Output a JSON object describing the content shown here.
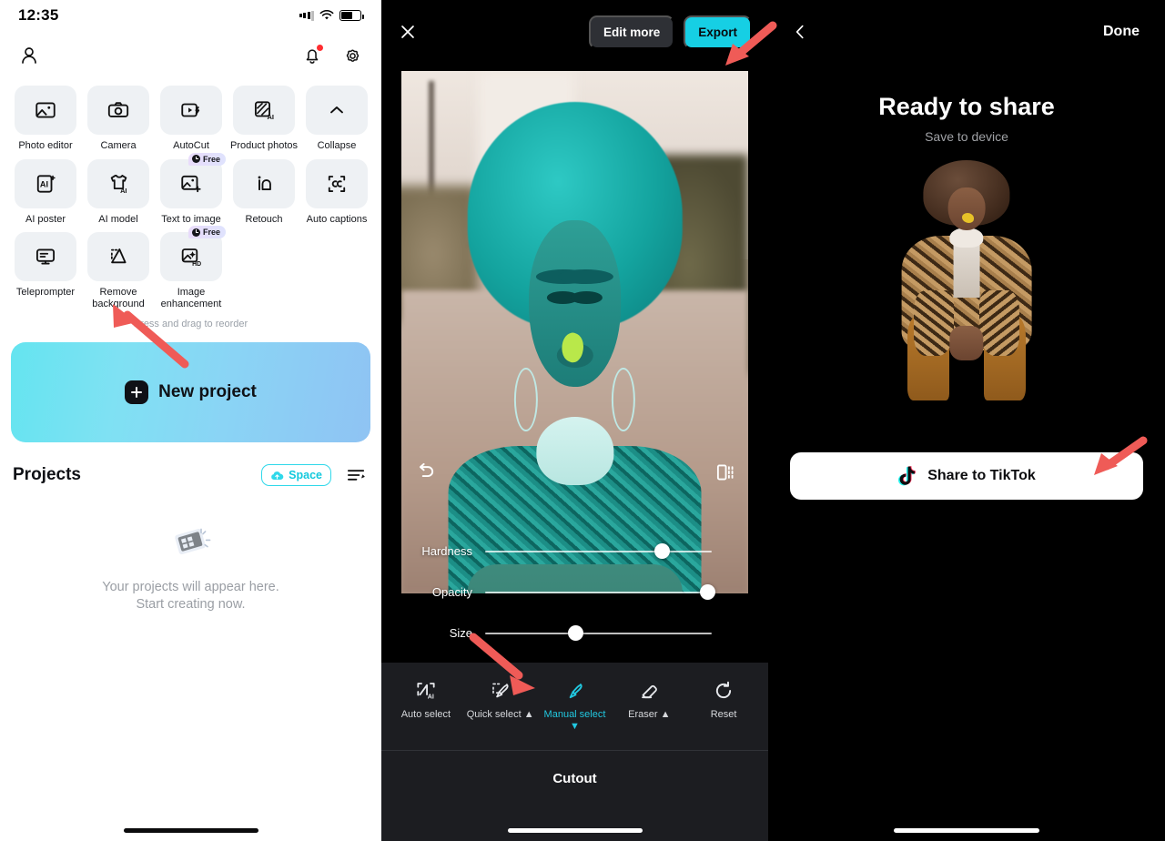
{
  "panel1": {
    "status": {
      "time": "12:35",
      "signal_icon": "cellular-signal-icon",
      "wifi_icon": "wifi-icon",
      "battery_icon": "battery-icon"
    },
    "appbar": {
      "profile_icon": "profile-icon",
      "notifications_icon": "bell-icon",
      "settings_icon": "gear-icon"
    },
    "tools": [
      {
        "label": "Photo editor",
        "icon": "photo-editor-icon",
        "badge": null
      },
      {
        "label": "Camera",
        "icon": "camera-icon",
        "badge": null
      },
      {
        "label": "AutoCut",
        "icon": "autocut-icon",
        "badge": null
      },
      {
        "label": "Product photos",
        "icon": "product-photos-icon",
        "badge": null
      },
      {
        "label": "Collapse",
        "icon": "chevron-up-icon",
        "badge": null
      },
      {
        "label": "AI poster",
        "icon": "ai-poster-icon",
        "badge": null
      },
      {
        "label": "AI model",
        "icon": "ai-model-icon",
        "badge": null
      },
      {
        "label": "Text to image",
        "icon": "text-to-image-icon",
        "badge": "Free"
      },
      {
        "label": "Retouch",
        "icon": "retouch-icon",
        "badge": null
      },
      {
        "label": "Auto captions",
        "icon": "auto-captions-icon",
        "badge": null
      },
      {
        "label": "Teleprompter",
        "icon": "teleprompter-icon",
        "badge": null
      },
      {
        "label": "Remove background",
        "icon": "remove-background-icon",
        "badge": null
      },
      {
        "label": "Image enhancement",
        "icon": "image-enhancement-icon",
        "badge": "Free"
      }
    ],
    "reorder_hint": "Press and drag to reorder",
    "new_project": {
      "label": "New project",
      "icon": "plus-icon"
    },
    "projects": {
      "title": "Projects",
      "space_label": "Space",
      "space_icon": "cloud-upload-icon",
      "list_view_icon": "list-edit-icon",
      "empty_icon": "film-strip-icon",
      "empty_line1": "Your projects will appear here.",
      "empty_line2": "Start creating now."
    }
  },
  "panel2": {
    "close_icon": "close-icon",
    "edit_more_label": "Edit more",
    "export_label": "Export",
    "undo_icon": "undo-icon",
    "compare_icon": "compare-icon",
    "sliders": [
      {
        "label": "Hardness",
        "value": 78
      },
      {
        "label": "Opacity",
        "value": 98
      },
      {
        "label": "Size",
        "value": 40
      }
    ],
    "tools": [
      {
        "label": "Auto select",
        "icon": "auto-select-icon",
        "active": false,
        "caret": ""
      },
      {
        "label": "Quick select",
        "icon": "quick-select-icon",
        "active": false,
        "caret": "▲"
      },
      {
        "label": "Manual select",
        "icon": "manual-select-icon",
        "active": true,
        "caret": "▼"
      },
      {
        "label": "Eraser",
        "icon": "eraser-icon",
        "active": false,
        "caret": "▲"
      },
      {
        "label": "Reset",
        "icon": "reset-icon",
        "active": false,
        "caret": ""
      }
    ],
    "sheet_title": "Cutout"
  },
  "panel3": {
    "back_icon": "chevron-left-icon",
    "done_label": "Done",
    "title": "Ready to share",
    "subtitle": "Save to device",
    "preview_name": "cutout-preview-image",
    "share_button": {
      "label": "Share to TikTok",
      "icon": "tiktok-icon"
    }
  },
  "colors": {
    "accent_cyan": "#16cfe4",
    "tool_tile": "#eef1f4",
    "dark_panel": "#1c1d21",
    "annotation_arrow": "#ef5b57"
  }
}
